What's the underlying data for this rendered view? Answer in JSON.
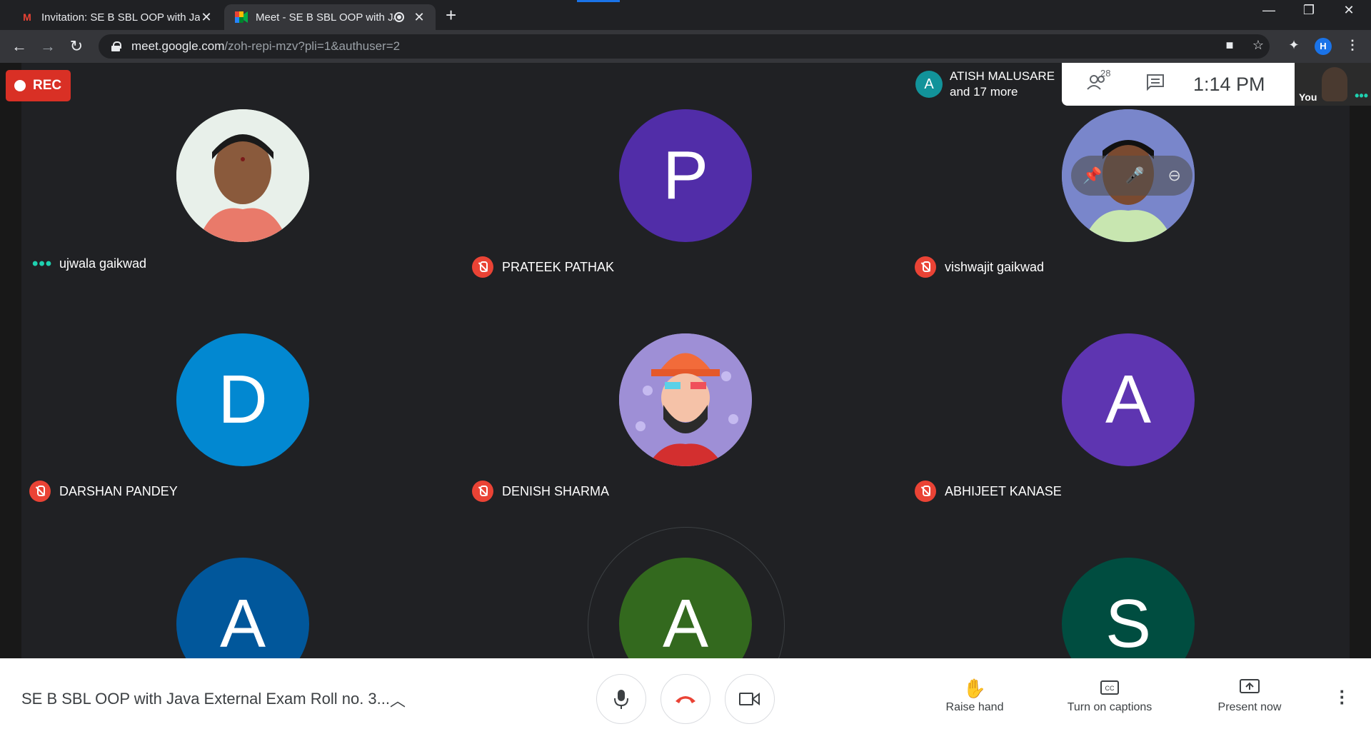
{
  "browser": {
    "tabs": [
      {
        "title": "Invitation: SE B SBL OOP with Jav",
        "icon": "gmail-icon"
      },
      {
        "title": "Meet - SE B SBL OOP with Ja",
        "icon": "meet-icon"
      }
    ],
    "new_tab": "+",
    "url_host": "meet.google.com",
    "url_path": "/zoh-repi-mzv?pli=1&authuser=2",
    "profile_initial": "H",
    "window_controls": [
      "—",
      "❐",
      "✕"
    ]
  },
  "meet": {
    "rec_label": "REC",
    "presenter": {
      "initial": "A",
      "name": "ATISH MALUSARE",
      "more": "and 17 more"
    },
    "participant_count": "28",
    "clock": "1:14 PM",
    "self_label": "You",
    "participants": [
      {
        "name": "ujwala gaikwad",
        "initial": "",
        "color": "#d9e4dc",
        "muted": false,
        "photo": true
      },
      {
        "name": "PRATEEK PATHAK",
        "initial": "P",
        "color": "#512da8",
        "muted": true,
        "photo": false
      },
      {
        "name": "vishwajit gaikwad",
        "initial": "",
        "color": "#7986cb",
        "muted": true,
        "photo": true
      },
      {
        "name": "DARSHAN PANDEY",
        "initial": "D",
        "color": "#0288d1",
        "muted": true,
        "photo": false
      },
      {
        "name": "DENISH SHARMA",
        "initial": "",
        "color": "#9e8fd6",
        "muted": true,
        "photo": true
      },
      {
        "name": "ABHIJEET KANASE",
        "initial": "A",
        "color": "#5e35b1",
        "muted": true,
        "photo": false
      },
      {
        "name": "",
        "initial": "A",
        "color": "#01579b",
        "muted": false,
        "photo": false
      },
      {
        "name": "",
        "initial": "A",
        "color": "#33691e",
        "muted": false,
        "photo": false
      },
      {
        "name": "",
        "initial": "S",
        "color": "#004d40",
        "muted": false,
        "photo": false
      }
    ]
  },
  "bottom_bar": {
    "meeting_title": "SE B SBL OOP with Java External Exam Roll no. 3...",
    "raise_hand": "Raise hand",
    "captions": "Turn on captions",
    "present": "Present now"
  }
}
